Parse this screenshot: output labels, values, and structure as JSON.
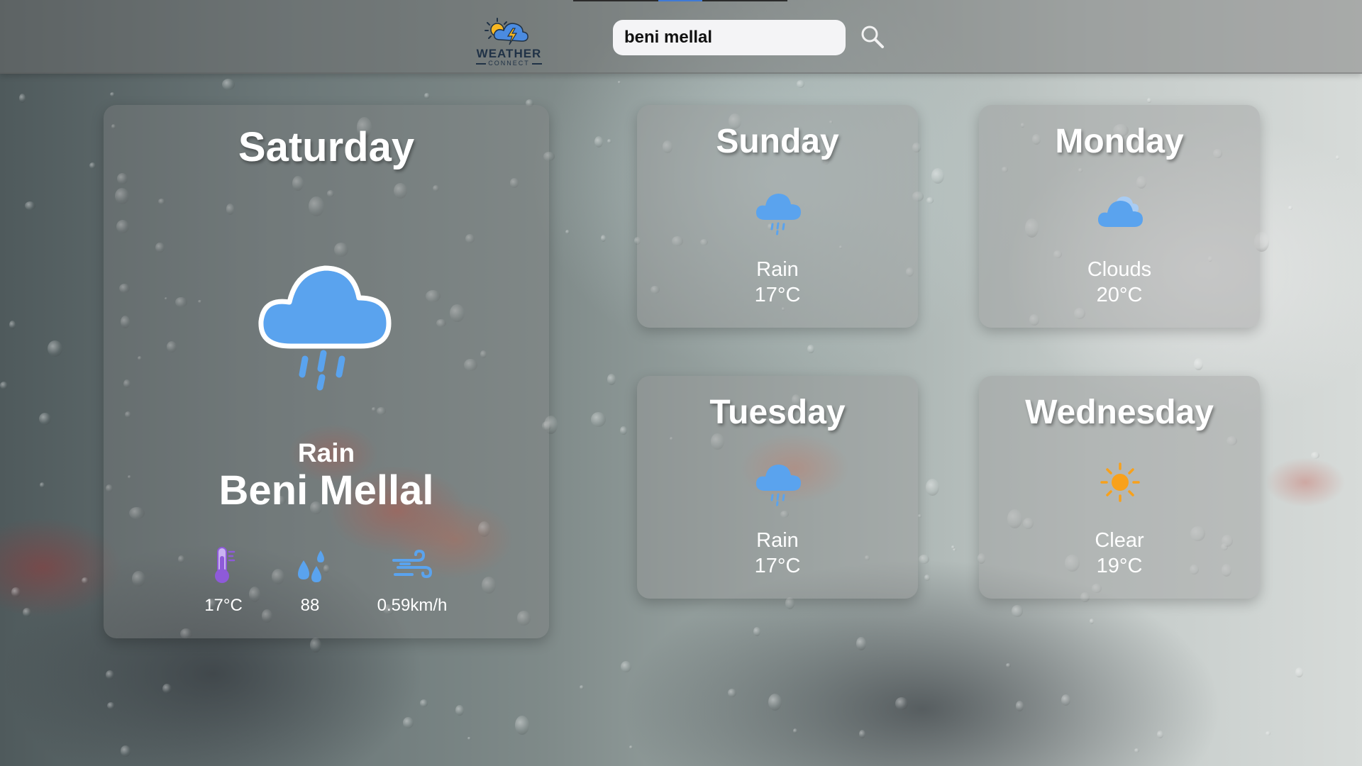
{
  "app": {
    "logo_text": "WEATHER",
    "logo_subtext": "CONNECT"
  },
  "search": {
    "value": "beni mellal",
    "placeholder": ""
  },
  "today": {
    "day": "Saturday",
    "condition": "Rain",
    "icon": "rain-cloud-icon",
    "city": "Beni Mellal",
    "stats": {
      "temperature": "17°C",
      "humidity": "88",
      "wind": "0.59km/h"
    }
  },
  "forecast": [
    {
      "day": "Sunday",
      "condition": "Rain",
      "temp": "17°C",
      "icon": "rain-cloud-icon"
    },
    {
      "day": "Monday",
      "condition": "Clouds",
      "temp": "20°C",
      "icon": "clouds-icon"
    },
    {
      "day": "Tuesday",
      "condition": "Rain",
      "temp": "17°C",
      "icon": "rain-cloud-icon"
    },
    {
      "day": "Wednesday",
      "condition": "Clear",
      "temp": "19°C",
      "icon": "sun-icon"
    }
  ],
  "colors": {
    "accent": "#3f7ad6",
    "icon_blue": "#5aa3ee",
    "sun": "#f8a11b",
    "thermo": "#8e5ad9"
  }
}
